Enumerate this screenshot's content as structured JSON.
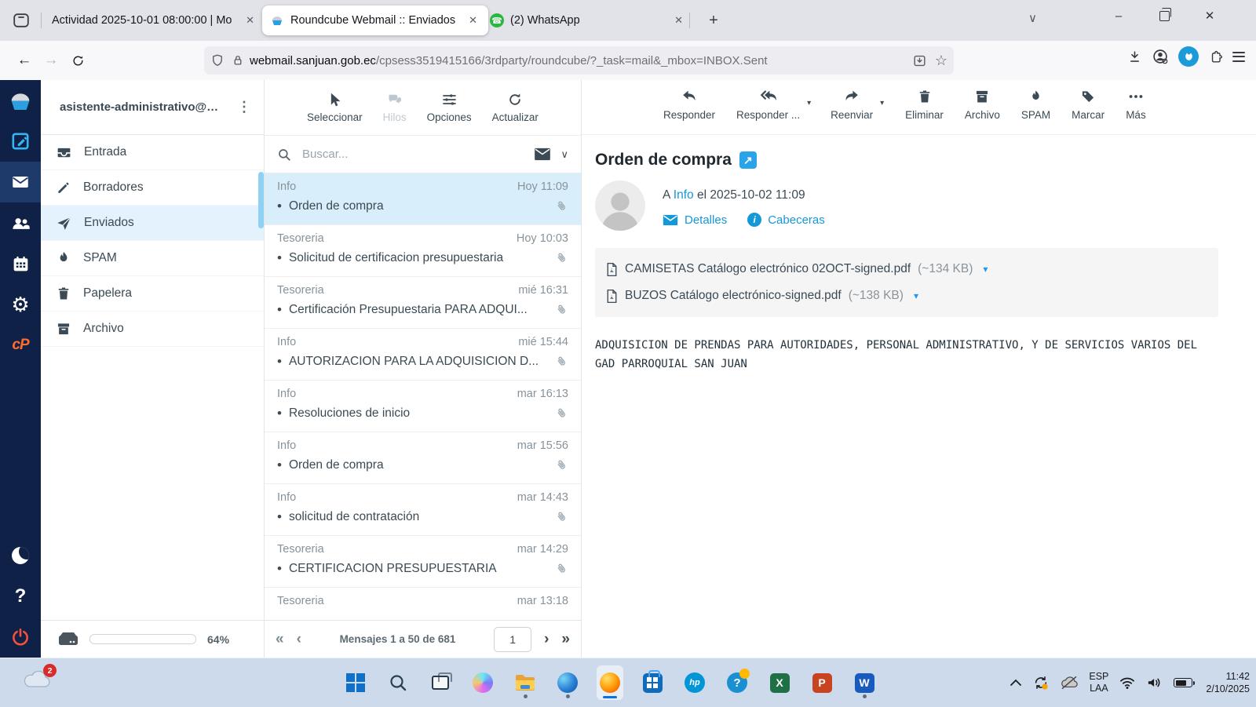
{
  "icons": {
    "bullet": "•",
    "kebab": "⋮",
    "caret_down": "▾",
    "chevron_down": "∨",
    "external": "↗",
    "close": "✕",
    "minimize": "–",
    "plus": "+",
    "first": "«",
    "prev": "‹",
    "next": "›",
    "last": "»",
    "back": "←",
    "forward": "→",
    "star": "☆",
    "gear": "⚙",
    "question": "?",
    "phone": "☎",
    "info_i": "i",
    "hp": "hp",
    "excel": "X",
    "powerpoint": "P",
    "word": "W"
  },
  "browser": {
    "tabs": [
      {
        "title": "Actividad 2025-10-01 08:00:00 | Mo"
      },
      {
        "title": "Roundcube Webmail :: Enviados"
      },
      {
        "title": "(2) WhatsApp"
      }
    ],
    "url": {
      "host": "webmail.sanjuan.gob.ec",
      "path": "/cpsess3519415166/3rdparty/roundcube/?_task=mail&_mbox=INBOX.Sent"
    }
  },
  "webmail": {
    "account": "asistente-administrativo@…",
    "folders": [
      {
        "label": "Entrada"
      },
      {
        "label": "Borradores"
      },
      {
        "label": "Enviados",
        "selected": true
      },
      {
        "label": "SPAM"
      },
      {
        "label": "Papelera"
      },
      {
        "label": "Archivo"
      }
    ],
    "quota": {
      "percent": 64,
      "label": "64%"
    },
    "list_toolbar": {
      "select": "Seleccionar",
      "threads": "Hilos",
      "options": "Opciones",
      "refresh": "Actualizar"
    },
    "search": {
      "placeholder": "Buscar..."
    },
    "messages": [
      {
        "from": "Info",
        "date": "Hoy 11:09",
        "subject": "Orden de compra",
        "selected": true
      },
      {
        "from": "Tesoreria",
        "date": "Hoy 10:03",
        "subject": "Solicitud de certificacion presupuestaria"
      },
      {
        "from": "Tesoreria",
        "date": "mié 16:31",
        "subject": "Certificación Presupuestaria PARA ADQUI..."
      },
      {
        "from": "Info",
        "date": "mié 15:44",
        "subject": "AUTORIZACION PARA LA ADQUISICION D..."
      },
      {
        "from": "Info",
        "date": "mar 16:13",
        "subject": "Resoluciones de inicio"
      },
      {
        "from": "Info",
        "date": "mar 15:56",
        "subject": "Orden de compra"
      },
      {
        "from": "Info",
        "date": "mar 14:43",
        "subject": "solicitud de contratación"
      },
      {
        "from": "Tesoreria",
        "date": "mar 14:29",
        "subject": "CERTIFICACION PRESUPUESTARIA"
      },
      {
        "from": "Tesoreria",
        "date": "mar 13:18",
        "subject": ""
      }
    ],
    "pagination": {
      "label": "Mensajes 1 a 50 de 681",
      "page": "1"
    },
    "view_toolbar": {
      "reply": "Responder",
      "reply_all": "Responder ...",
      "forward": "Reenviar",
      "delete": "Eliminar",
      "archive": "Archivo",
      "spam": "SPAM",
      "mark": "Marcar",
      "more": "Más"
    },
    "message": {
      "subject": "Orden de compra",
      "to_prefix": "A",
      "to_name": "Info",
      "date_line": "el 2025-10-02 11:09",
      "details": "Detalles",
      "headers": "Cabeceras",
      "attachments": [
        {
          "name": "CAMISETAS Catálogo electrónico 02OCT-signed.pdf",
          "size": "(~134 KB)"
        },
        {
          "name": "BUZOS Catálogo electrónico-signed.pdf",
          "size": "(~138 KB)"
        }
      ],
      "body": "ADQUISICION DE PRENDAS PARA AUTORIDADES, PERSONAL ADMINISTRATIVO, Y DE SERVICIOS VARIOS DEL GAD PARROQUIAL SAN JUAN"
    }
  },
  "taskbar": {
    "onedrive_badge": "2",
    "tray": {
      "lang_top": "ESP",
      "lang_bottom": "LAA",
      "time": "11:42",
      "date": "2/10/2025"
    }
  }
}
